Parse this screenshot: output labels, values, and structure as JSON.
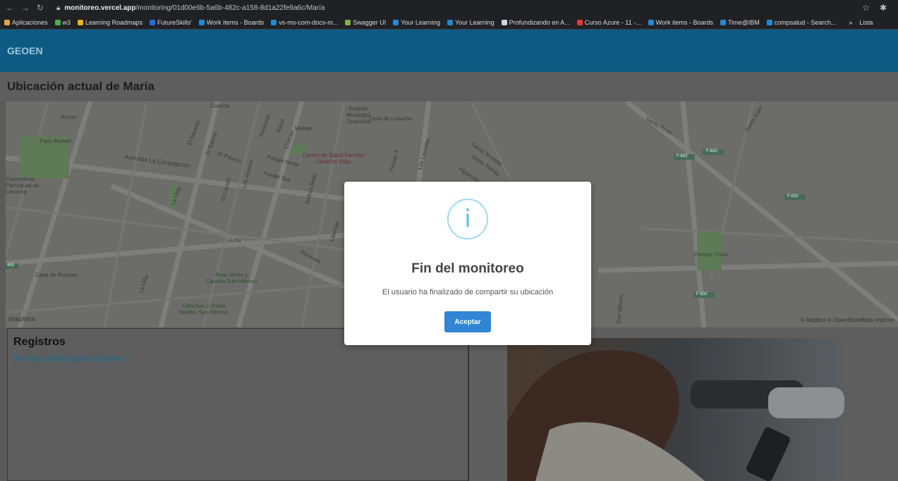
{
  "browser": {
    "url_host": "monitoreo.vercel.app",
    "url_path": "/monitoring/01d00e6b-5a6b-482c-a158-8d1a22fe9a6c/María",
    "bookmarks": [
      {
        "label": "Aplicaciones",
        "color": "#e8a33d"
      },
      {
        "label": "w3",
        "color": "#4caf50"
      },
      {
        "label": "Learning Roadmaps",
        "color": "#f4b400"
      },
      {
        "label": "FutureSkills'",
        "color": "#1e6fd9"
      },
      {
        "label": "Work items - Boards",
        "color": "#1f8ad8"
      },
      {
        "label": "vs-ms-com-docs-m...",
        "color": "#1f8ad8"
      },
      {
        "label": "Swagger UI",
        "color": "#7cb342"
      },
      {
        "label": "Your Learning",
        "color": "#1f8ad8"
      },
      {
        "label": "Your Learning",
        "color": "#1f8ad8"
      },
      {
        "label": "Profundizando en A...",
        "color": "#cfd8dc"
      },
      {
        "label": "Curso Azure - 11 -...",
        "color": "#e53935"
      },
      {
        "label": "Work items - Boards",
        "color": "#1f8ad8"
      },
      {
        "label": "Time@IBM",
        "color": "#1f8ad8"
      },
      {
        "label": "compsalud - Search...",
        "color": "#1f8ad8"
      }
    ],
    "bookmarks_more": "»",
    "reading_list": "Lista"
  },
  "app": {
    "brand": "GEOEN",
    "page_title": "Ubicación actual de María"
  },
  "map": {
    "labels": {
      "ancon": "Ancon",
      "pass_market": "Pass Market",
      "cancha": "Cancha",
      "estadio": "Estadio Municipal Ocaranza",
      "feria": "Feria de Limache",
      "avenida": "Avenida La Concepción",
      "el_naranjo": "El Naranjo",
      "el_espino": "El Espino",
      "el_peumo": "El Peumo",
      "alaraceer": "Alaraceer",
      "raluli": "Raluli",
      "chacao": "Chacao",
      "mahao": "Mahao",
      "centro_salud": "Centro de Salud Familiar Limache Viejo",
      "pasaje_norte": "Pasaje Norte",
      "pasaje_sur": "Pasaje Sur",
      "pasaje4": "Pasaje 4",
      "los_laureles": "Los Laureles",
      "santa_teresita": "Santa Teresita",
      "santo_tomas": "Santo Tomás",
      "algarrobo": "Algarrobo",
      "cementerio": "Cementerio Parroquial de Limache",
      "la_vina": "La Viña",
      "el_canelo": "El Canelo",
      "los_aromos": "Los Aromos",
      "andres_bello": "Andres Bello",
      "libertad": "Libertad",
      "lota": "Lota",
      "nazareth": "Nazareth",
      "casa_reposo": "Casa de Reposo",
      "la_vina2": "La Viña",
      "area_verde": "Área Verde y Cancha San Alfonso",
      "canchas": "Canchas y Áreas Verdes San Alfonso",
      "santa_rosa": "Santa Rosa",
      "santa_ester": "Santa Ester",
      "parque_china": "Parque China",
      "don_alberto": "Don Alberto",
      "f632a": "F-632",
      "f630a": "F-630",
      "f630b": "F-630",
      "f632b": "F-632",
      "r443": "443"
    },
    "logo": "mapbox",
    "attribution": "© Mapbox © OpenStreetMap Improve"
  },
  "registros": {
    "title": "Registros",
    "empty_message": "No hay datos para mostrar :("
  },
  "modal": {
    "icon_glyph": "i",
    "title": "Fin del monitoreo",
    "text": "El usuario ha finalizado de compartir su ubicación",
    "button": "Aceptar"
  }
}
